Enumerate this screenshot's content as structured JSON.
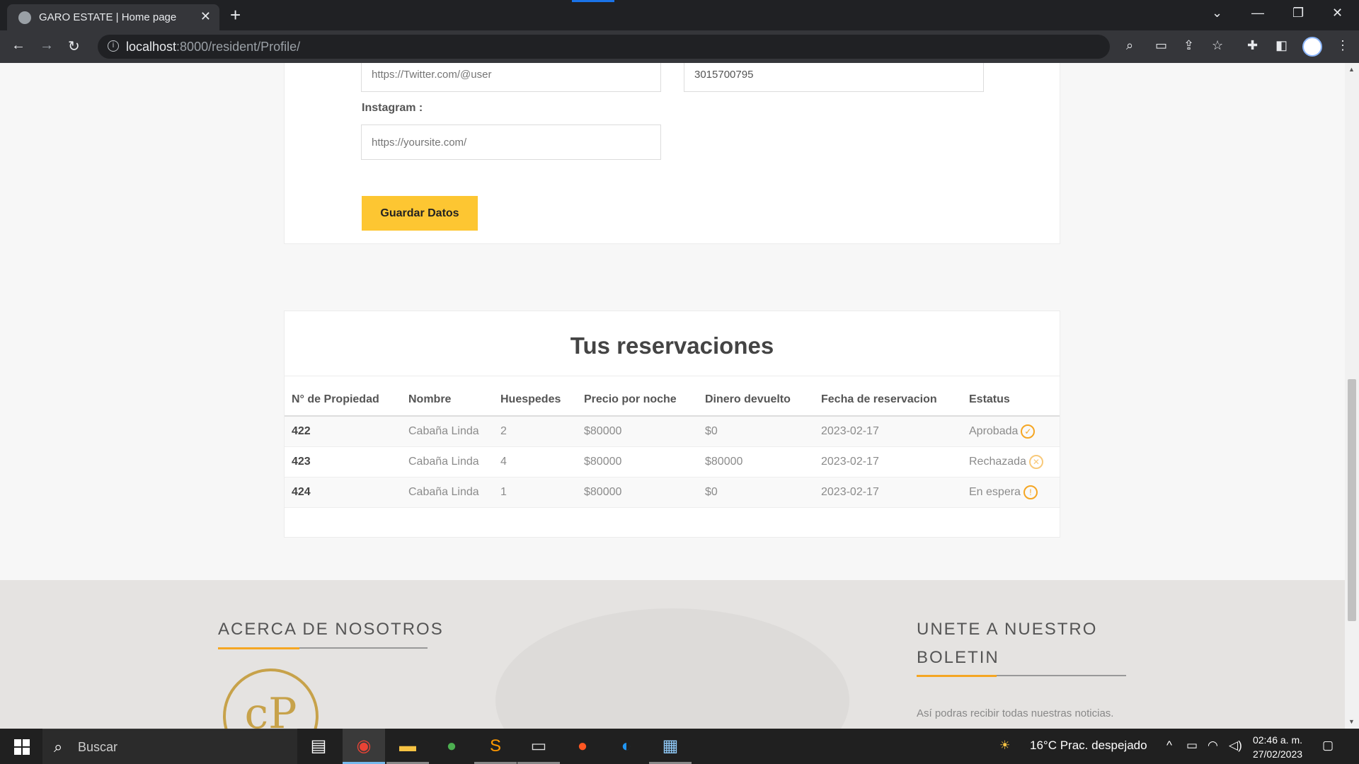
{
  "browser": {
    "tab_title": "GARO ESTATE | Home page",
    "close_glyph": "✕",
    "new_tab_glyph": "+",
    "url_host": "localhost",
    "url_path": ":8000/resident/Profile/"
  },
  "profile_form": {
    "twitter_placeholder": "https://Twitter.com/@user",
    "phone_value": "3015700795",
    "instagram_label": "Instagram :",
    "instagram_placeholder": "https://yoursite.com/",
    "save_label": "Guardar Datos"
  },
  "reservations": {
    "title": "Tus reservaciones",
    "columns": [
      "N° de Propiedad",
      "Nombre",
      "Huespedes",
      "Precio por noche",
      "Dinero devuelto",
      "Fecha de reservacion",
      "Estatus"
    ],
    "rows": [
      {
        "id": "422",
        "name": "Cabaña Linda",
        "guests": "2",
        "price": "$80000",
        "refund": "$0",
        "date": "2023-02-17",
        "status": "Aprobada",
        "status_icon": "check-circle-icon",
        "glyph": "✓"
      },
      {
        "id": "423",
        "name": "Cabaña Linda",
        "guests": "4",
        "price": "$80000",
        "refund": "$80000",
        "date": "2023-02-17",
        "status": "Rechazada",
        "status_icon": "x-circle-icon",
        "glyph": "✕"
      },
      {
        "id": "424",
        "name": "Cabaña Linda",
        "guests": "1",
        "price": "$80000",
        "refund": "$0",
        "date": "2023-02-17",
        "status": "En espera",
        "status_icon": "clock-icon",
        "glyph": "!"
      }
    ]
  },
  "footer": {
    "about_title": "ACERCA DE NOSOTROS",
    "newsletter_title_1": "UNETE A NUESTRO",
    "newsletter_title_2": "BOLETIN",
    "newsletter_text": "Así podras recibir todas nuestras noticias."
  },
  "taskbar": {
    "search_text": "Buscar",
    "weather": "16°C  Prac. despejado",
    "time": "02:46 a. m.",
    "date": "27/02/2023"
  },
  "colors": {
    "accent": "#fdc632",
    "status": "#f5a623"
  }
}
